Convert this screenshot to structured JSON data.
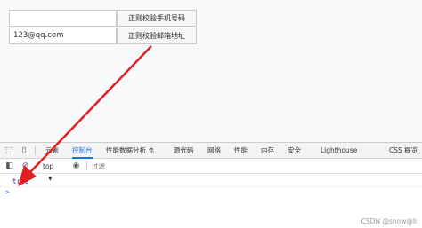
{
  "form": {
    "phone_value": "",
    "phone_button": "正则校验手机号码",
    "email_value": "123@qq.com",
    "email_button": "正则校验邮箱地址"
  },
  "devtools": {
    "tabs": [
      "元素",
      "控制台",
      "性能数据分析",
      "源代码",
      "网络",
      "性能",
      "内存",
      "安全",
      "Lighthouse",
      "CSS 概览"
    ],
    "active_tab": "控制台",
    "context": "top",
    "filter_placeholder": "过滤",
    "output": [
      "true"
    ],
    "prompt": ">"
  },
  "watermark": "CSDN @snow@li",
  "colors": {
    "accent": "#1a73e8",
    "arrow": "#e02020",
    "true_value": "#1a1aa6"
  }
}
